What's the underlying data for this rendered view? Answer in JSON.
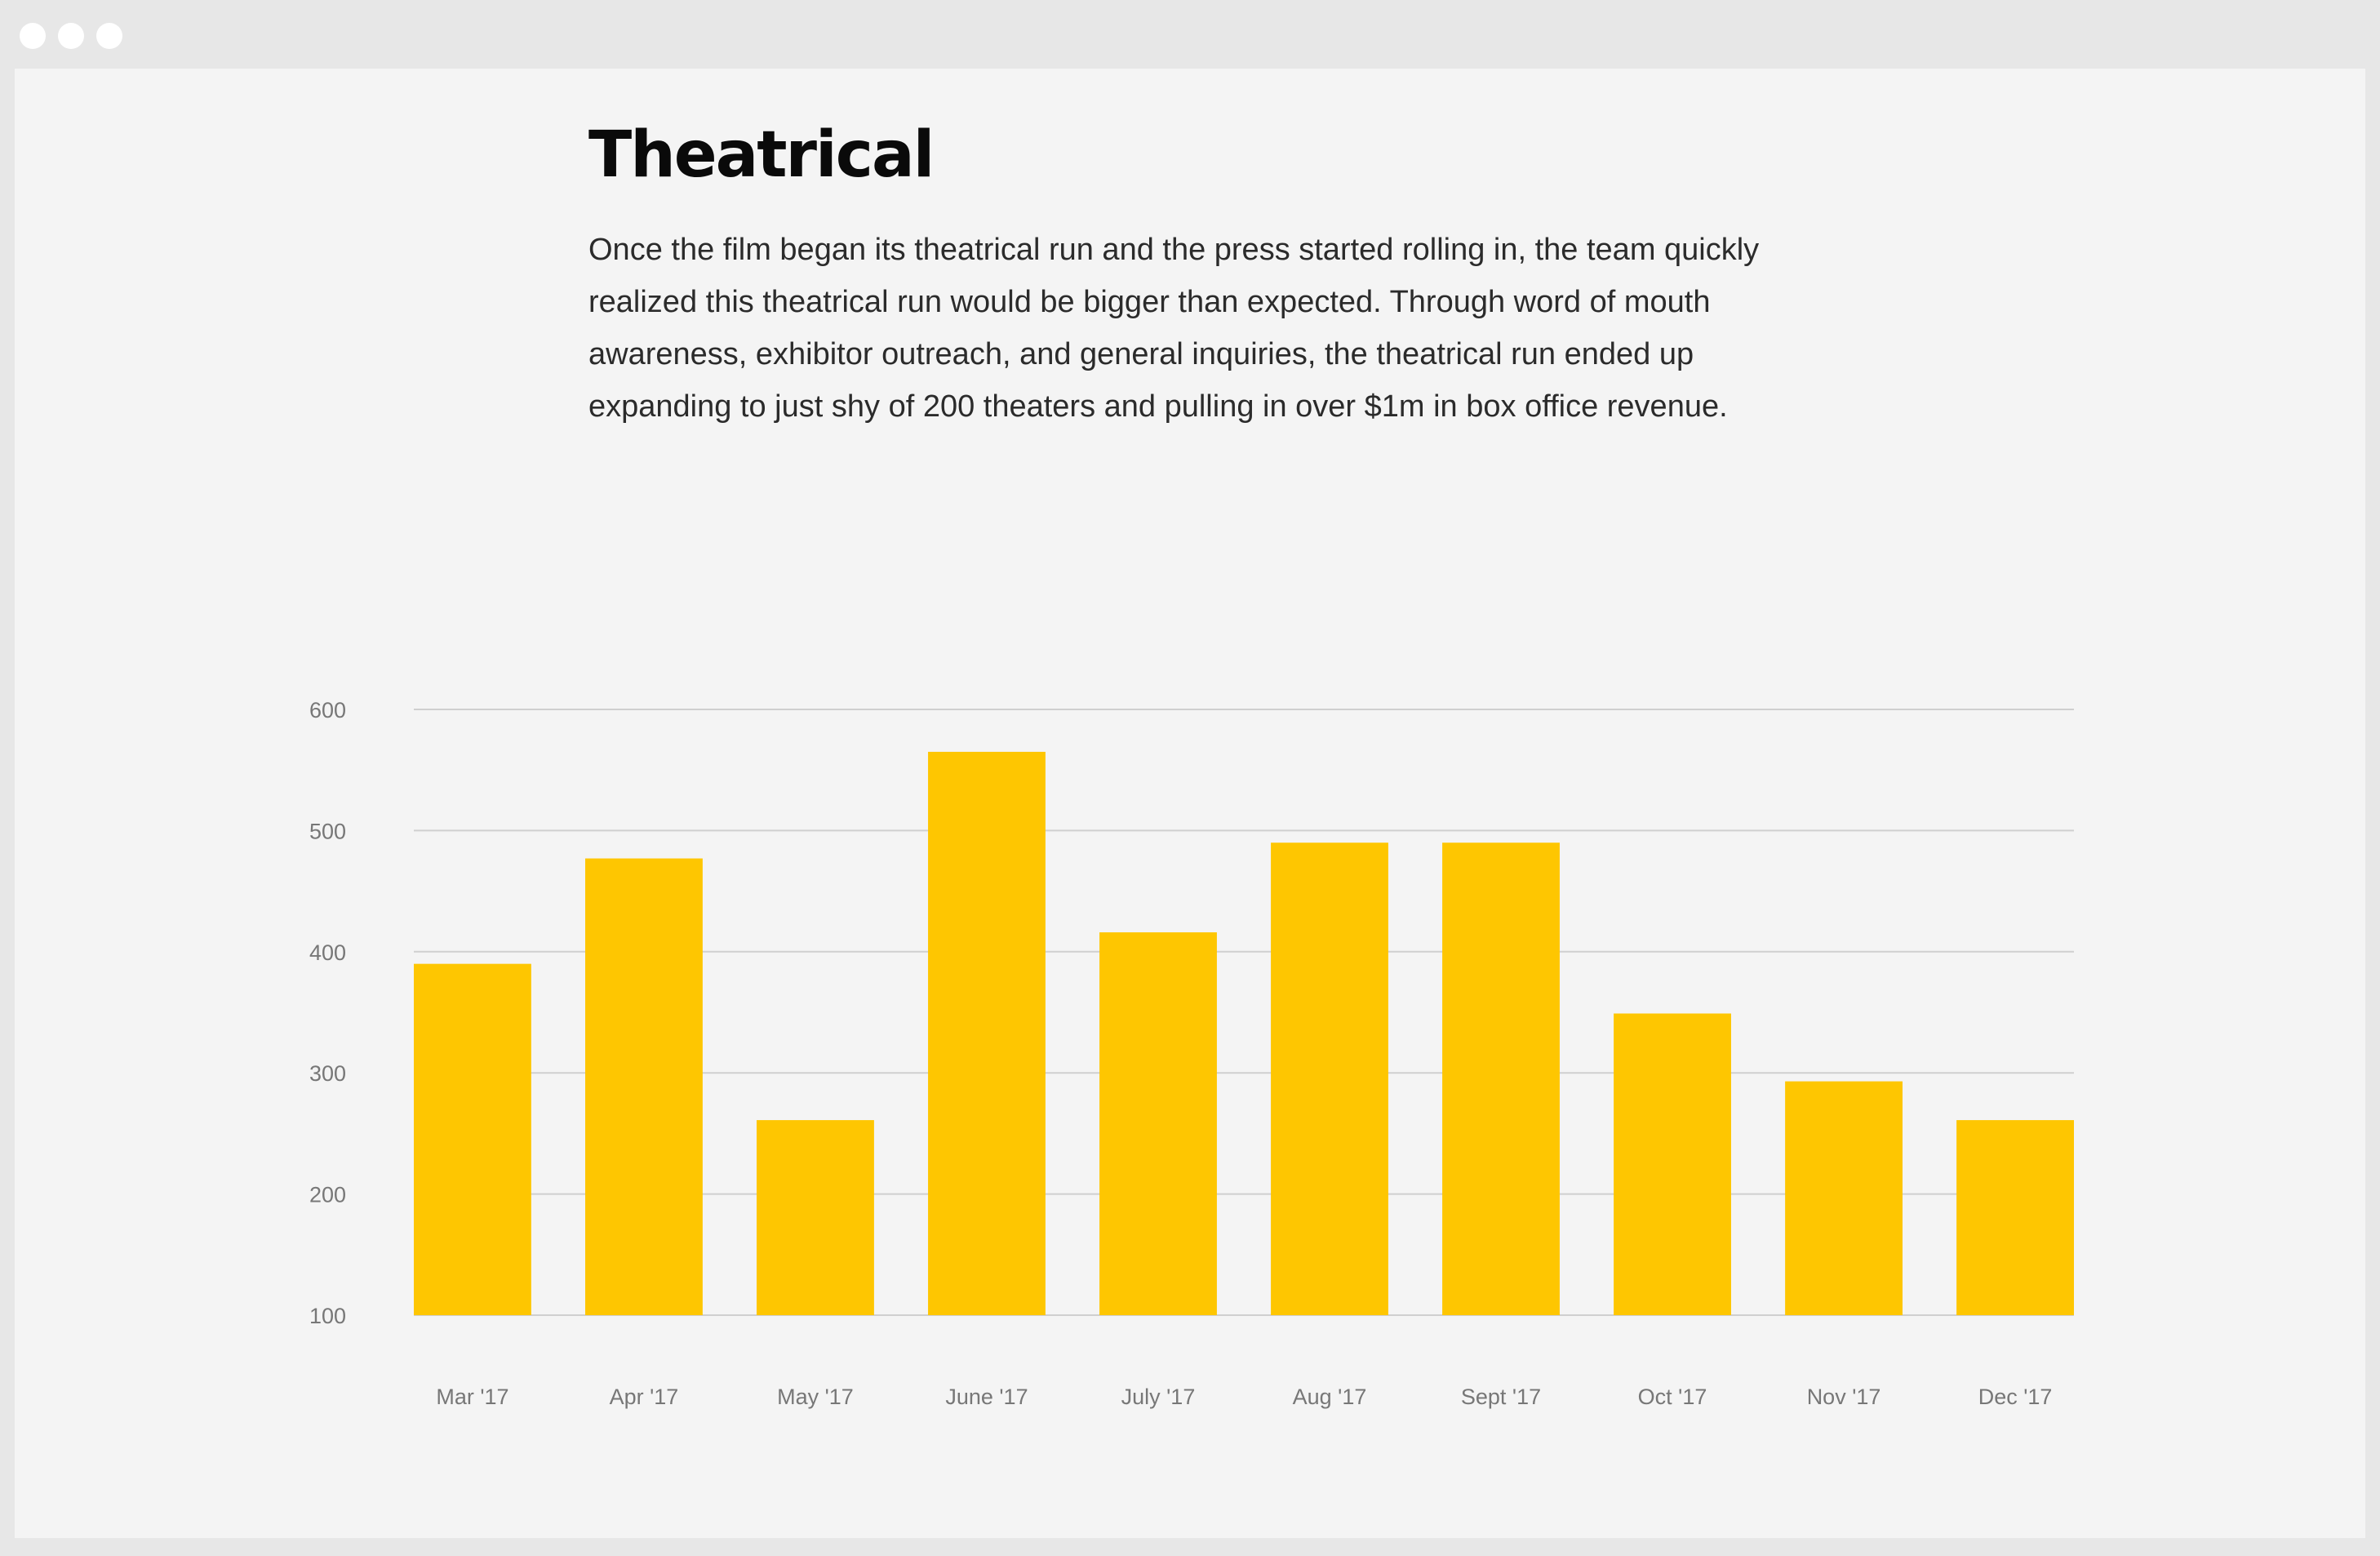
{
  "window": {
    "controls": [
      "close-dot",
      "minimize-dot",
      "zoom-dot"
    ]
  },
  "section": {
    "title": "Theatrical",
    "body": "Once the film began its theatrical run and the press started rolling in, the team quickly realized this theatrical run would be bigger than expected. Through word of mouth awareness, exhibitor outreach, and general inquiries, the theatrical run ended up expanding to just shy of 200 theaters and pulling in over $1m in box office revenue."
  },
  "colors": {
    "bar": "#fec601",
    "grid": "#cfcfcf",
    "tick": "#777777"
  },
  "chart_data": {
    "type": "bar",
    "title": "",
    "xlabel": "",
    "ylabel": "",
    "categories": [
      "Mar '17",
      "Apr '17",
      "May '17",
      "June '17",
      "July '17",
      "Aug '17",
      "Sept '17",
      "Oct '17",
      "Nov '17",
      "Dec '17"
    ],
    "values": [
      390,
      477,
      261,
      565,
      416,
      490,
      490,
      349,
      293,
      261
    ],
    "ylim": [
      100,
      600
    ],
    "yticks": [
      100,
      200,
      300,
      400,
      500,
      600
    ],
    "grid": true,
    "legend": "none"
  }
}
